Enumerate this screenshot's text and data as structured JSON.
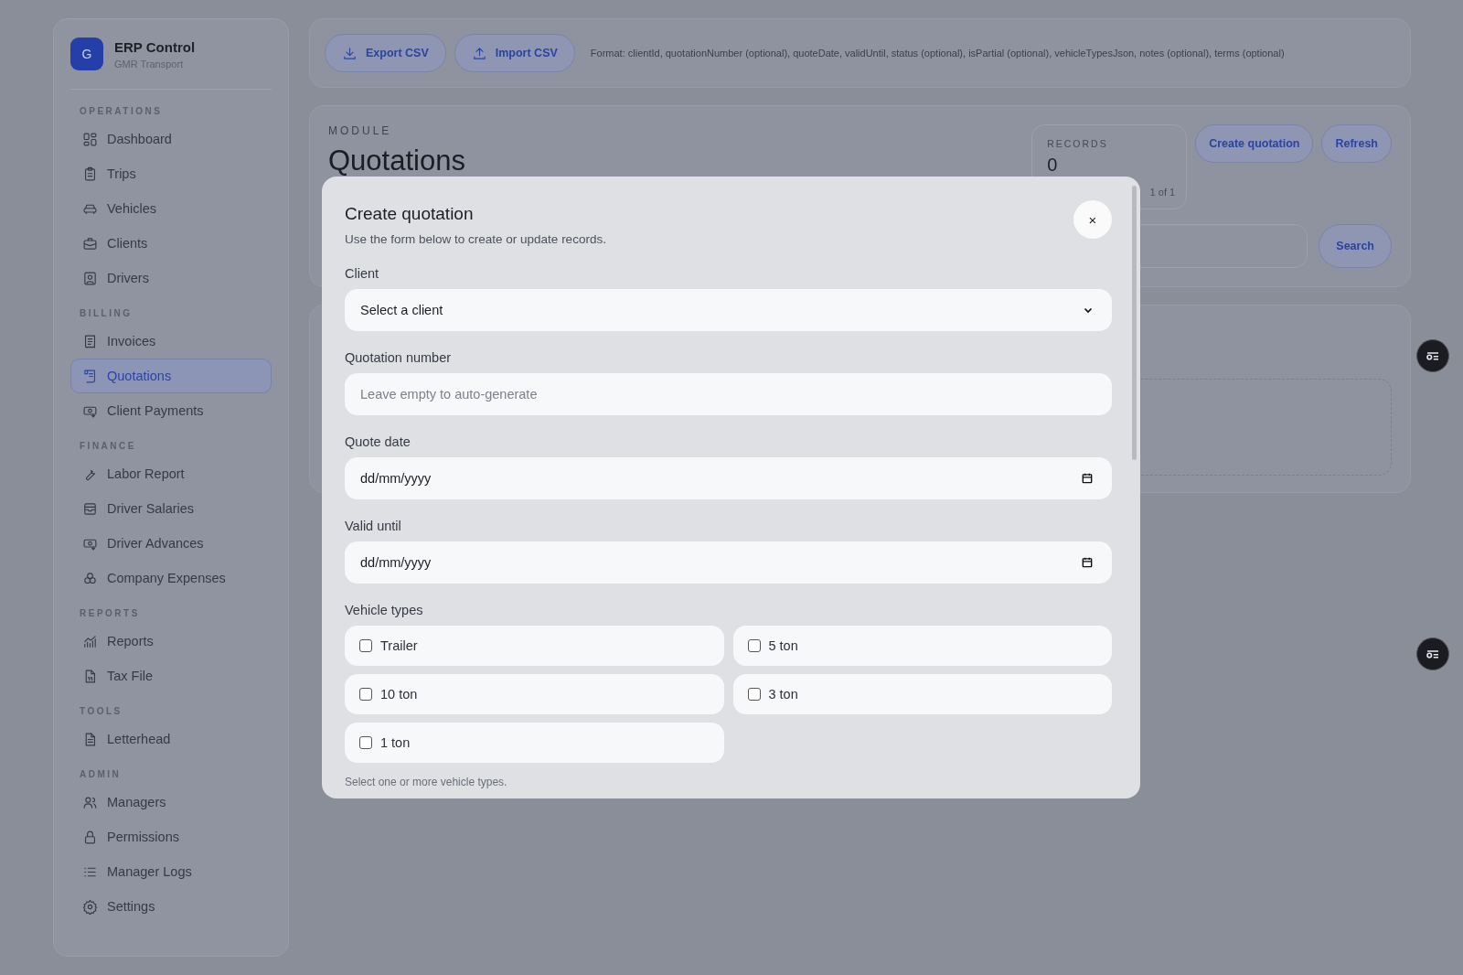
{
  "brand": {
    "logo_letter": "G",
    "name": "ERP Control",
    "subtitle": "GMR Transport"
  },
  "sidebar": {
    "sections": [
      {
        "title": "OPERATIONS",
        "items": [
          {
            "label": "Dashboard",
            "selected": false
          },
          {
            "label": "Trips",
            "selected": false
          },
          {
            "label": "Vehicles",
            "selected": false
          },
          {
            "label": "Clients",
            "selected": false
          },
          {
            "label": "Drivers",
            "selected": false
          }
        ]
      },
      {
        "title": "BILLING",
        "items": [
          {
            "label": "Invoices",
            "selected": false
          },
          {
            "label": "Quotations",
            "selected": true
          },
          {
            "label": "Client Payments",
            "selected": false
          }
        ]
      },
      {
        "title": "FINANCE",
        "items": [
          {
            "label": "Labor Report",
            "selected": false
          },
          {
            "label": "Driver Salaries",
            "selected": false
          },
          {
            "label": "Driver Advances",
            "selected": false
          },
          {
            "label": "Company Expenses",
            "selected": false
          }
        ]
      },
      {
        "title": "REPORTS",
        "items": [
          {
            "label": "Reports",
            "selected": false
          },
          {
            "label": "Tax File",
            "selected": false
          }
        ]
      },
      {
        "title": "TOOLS",
        "items": [
          {
            "label": "Letterhead",
            "selected": false
          }
        ]
      },
      {
        "title": "ADMIN",
        "items": [
          {
            "label": "Managers",
            "selected": false
          },
          {
            "label": "Permissions",
            "selected": false
          },
          {
            "label": "Manager Logs",
            "selected": false
          },
          {
            "label": "Settings",
            "selected": false
          }
        ]
      }
    ]
  },
  "toolbar": {
    "buttons": [
      {
        "label": "Export CSV",
        "kind": "download"
      },
      {
        "label": "Import CSV",
        "kind": "upload"
      }
    ],
    "format_note": "Format: clientId, quotationNumber (optional), quoteDate, validUntil, status (optional), isPartial (optional), vehicleTypesJson, notes (optional), terms (optional)"
  },
  "module": {
    "eyebrow": "MODULE",
    "title": "Quotations",
    "records": {
      "label": "RECORDS",
      "value": "0",
      "pages": "1 of 1"
    },
    "buttons": [
      "Create quotation",
      "Refresh"
    ],
    "search_button": "Search"
  },
  "modal": {
    "title": "Create quotation",
    "subtitle": "Use the form below to create or update records.",
    "close": "×",
    "fields": [
      {
        "kind": "select",
        "label": "Client",
        "value": "Select a client"
      },
      {
        "kind": "text",
        "label": "Quotation number",
        "placeholder": "Leave empty to auto-generate"
      },
      {
        "kind": "date",
        "label": "Quote date",
        "value": "dd/mm/yyyy"
      },
      {
        "kind": "date",
        "label": "Valid until",
        "value": "dd/mm/yyyy"
      }
    ],
    "vehicle_types": {
      "label": "Vehicle types",
      "options": [
        {
          "label": "Trailer",
          "checked": false
        },
        {
          "label": "5 ton",
          "checked": false
        },
        {
          "label": "10 ton",
          "checked": false
        },
        {
          "label": "3 ton",
          "checked": false
        },
        {
          "label": "1 ton",
          "checked": false
        }
      ],
      "hint": "Select one or more vehicle types."
    }
  }
}
